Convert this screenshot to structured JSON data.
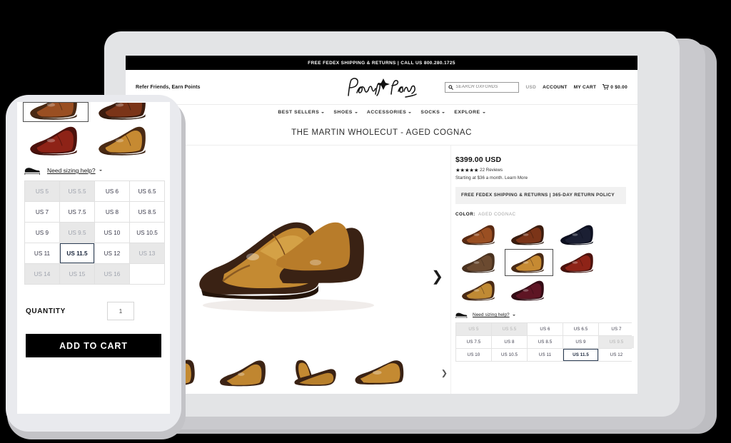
{
  "promo": {
    "text": "FREE FEDEX SHIPPING & RETURNS  |  CALL US 800.280.1725"
  },
  "header": {
    "refer_link": "Refer Friends, Earn Points",
    "brand": "Paul Evans",
    "search_placeholder": "SEARCH OXFORDS",
    "search_value": "",
    "currency": "USD",
    "account": "ACCOUNT",
    "my_cart": "MY CART",
    "cart_count": "0",
    "cart_total": "$0.00"
  },
  "nav": {
    "items": [
      {
        "label": "BEST SELLERS"
      },
      {
        "label": "SHOES"
      },
      {
        "label": "ACCESSORIES"
      },
      {
        "label": "SOCKS"
      },
      {
        "label": "EXPLORE"
      }
    ]
  },
  "product": {
    "title": "THE MARTIN WHOLECUT - AGED COGNAC",
    "price": "$399.00 USD",
    "stars": "★★★★★",
    "review_count": "22 Reviews",
    "financing": "Starting at $36 a month. Learn More",
    "shipping_note": "FREE FEDEX SHIPPING & RETURNS | 365-DAY RETURN POLICY",
    "color_label": "COLOR:",
    "color_value": "AGED COGNAC",
    "sizing_help": "Need sizing help?",
    "quantity_label": "QUANTITY",
    "quantity_value": "1",
    "add_to_cart": "ADD TO CART",
    "next_arrow": "❯"
  },
  "colors": [
    {
      "name": "Chestnut Brown",
      "selected": false,
      "upper": "#9a4f22",
      "toe": "#5a2a12",
      "sole": "#3a2414"
    },
    {
      "name": "Dark Walnut",
      "selected": false,
      "upper": "#7b3418",
      "toe": "#3c1c0e",
      "sole": "#2c180c"
    },
    {
      "name": "Midnight Navy",
      "selected": false,
      "upper": "#1b1f33",
      "toe": "#0d1020",
      "sole": "#0a0c18"
    },
    {
      "name": "Brown Suede",
      "selected": false,
      "upper": "#6b4a30",
      "toe": "#4a3220",
      "sole": "#38261a"
    },
    {
      "name": "Aged Cognac",
      "selected": true,
      "upper": "#c68a32",
      "toe": "#4a2a14",
      "sole": "#3a2010"
    },
    {
      "name": "Oxblood Red",
      "selected": false,
      "upper": "#8e2317",
      "toe": "#4d120c",
      "sole": "#3a0e09"
    },
    {
      "name": "Golden Tan",
      "selected": false,
      "upper": "#c08a34",
      "toe": "#4a2a14",
      "sole": "#3a2010"
    },
    {
      "name": "Burgundy Patina",
      "selected": false,
      "upper": "#5e1524",
      "toe": "#340b14",
      "sole": "#28080f"
    }
  ],
  "gallery": {
    "thumbs": [
      {
        "view": "three-quarter-pair"
      },
      {
        "view": "angled-pair"
      },
      {
        "view": "stacked-pair"
      },
      {
        "view": "side-profile"
      }
    ],
    "next_arrow": "❯"
  },
  "sizes_desktop": [
    {
      "label": "US 5",
      "state": "disabled"
    },
    {
      "label": "US 5.5",
      "state": "disabled"
    },
    {
      "label": "US 6",
      "state": "available"
    },
    {
      "label": "US 6.5",
      "state": "available"
    },
    {
      "label": "US 7",
      "state": "available"
    },
    {
      "label": "US 7.5",
      "state": "available"
    },
    {
      "label": "US 8",
      "state": "available"
    },
    {
      "label": "US 8.5",
      "state": "available"
    },
    {
      "label": "US 9",
      "state": "available"
    },
    {
      "label": "US 9.5",
      "state": "disabled"
    },
    {
      "label": "US 10",
      "state": "available"
    },
    {
      "label": "US 10.5",
      "state": "available"
    },
    {
      "label": "US 11",
      "state": "available"
    },
    {
      "label": "US 11.5",
      "state": "selected"
    },
    {
      "label": "US 12",
      "state": "available"
    }
  ],
  "sizes_mobile": [
    {
      "label": "US 5",
      "state": "disabled"
    },
    {
      "label": "US 5.5",
      "state": "disabled"
    },
    {
      "label": "US 6",
      "state": "available"
    },
    {
      "label": "US 6.5",
      "state": "available"
    },
    {
      "label": "US 7",
      "state": "available"
    },
    {
      "label": "US 7.5",
      "state": "available"
    },
    {
      "label": "US 8",
      "state": "available"
    },
    {
      "label": "US 8.5",
      "state": "available"
    },
    {
      "label": "US 9",
      "state": "available"
    },
    {
      "label": "US 9.5",
      "state": "disabled"
    },
    {
      "label": "US 10",
      "state": "available"
    },
    {
      "label": "US 10.5",
      "state": "available"
    },
    {
      "label": "US 11",
      "state": "available"
    },
    {
      "label": "US 11.5",
      "state": "selected"
    },
    {
      "label": "US 12",
      "state": "available"
    },
    {
      "label": "US 13",
      "state": "disabled"
    },
    {
      "label": "US 14",
      "state": "disabled"
    },
    {
      "label": "US 15",
      "state": "disabled"
    },
    {
      "label": "US 16",
      "state": "disabled"
    },
    {
      "label": "",
      "state": "empty"
    }
  ],
  "mobile_swatches": [
    {
      "name": "Chestnut Brown",
      "selected": true,
      "cut": true,
      "upper": "#9a4f22",
      "toe": "#4a2a14",
      "sole": "#3a2414"
    },
    {
      "name": "Dark Walnut",
      "selected": false,
      "cut": true,
      "upper": "#7b3418",
      "toe": "#3c1c0e",
      "sole": "#2c180c"
    },
    {
      "name": "Oxblood Red",
      "selected": false,
      "cut": false,
      "upper": "#8e2317",
      "toe": "#4d120c",
      "sole": "#3a0e09"
    },
    {
      "name": "Aged Cognac",
      "selected": false,
      "cut": false,
      "upper": "#c68a32",
      "toe": "#4a2a14",
      "sole": "#3a2010"
    }
  ],
  "theme": {
    "canvas": "#000000",
    "device_frame": "#e3e4e6",
    "phone_frame": "#e9eaee",
    "accent_selected": "#2d3e55",
    "disabled_bg": "#eaeaea"
  }
}
